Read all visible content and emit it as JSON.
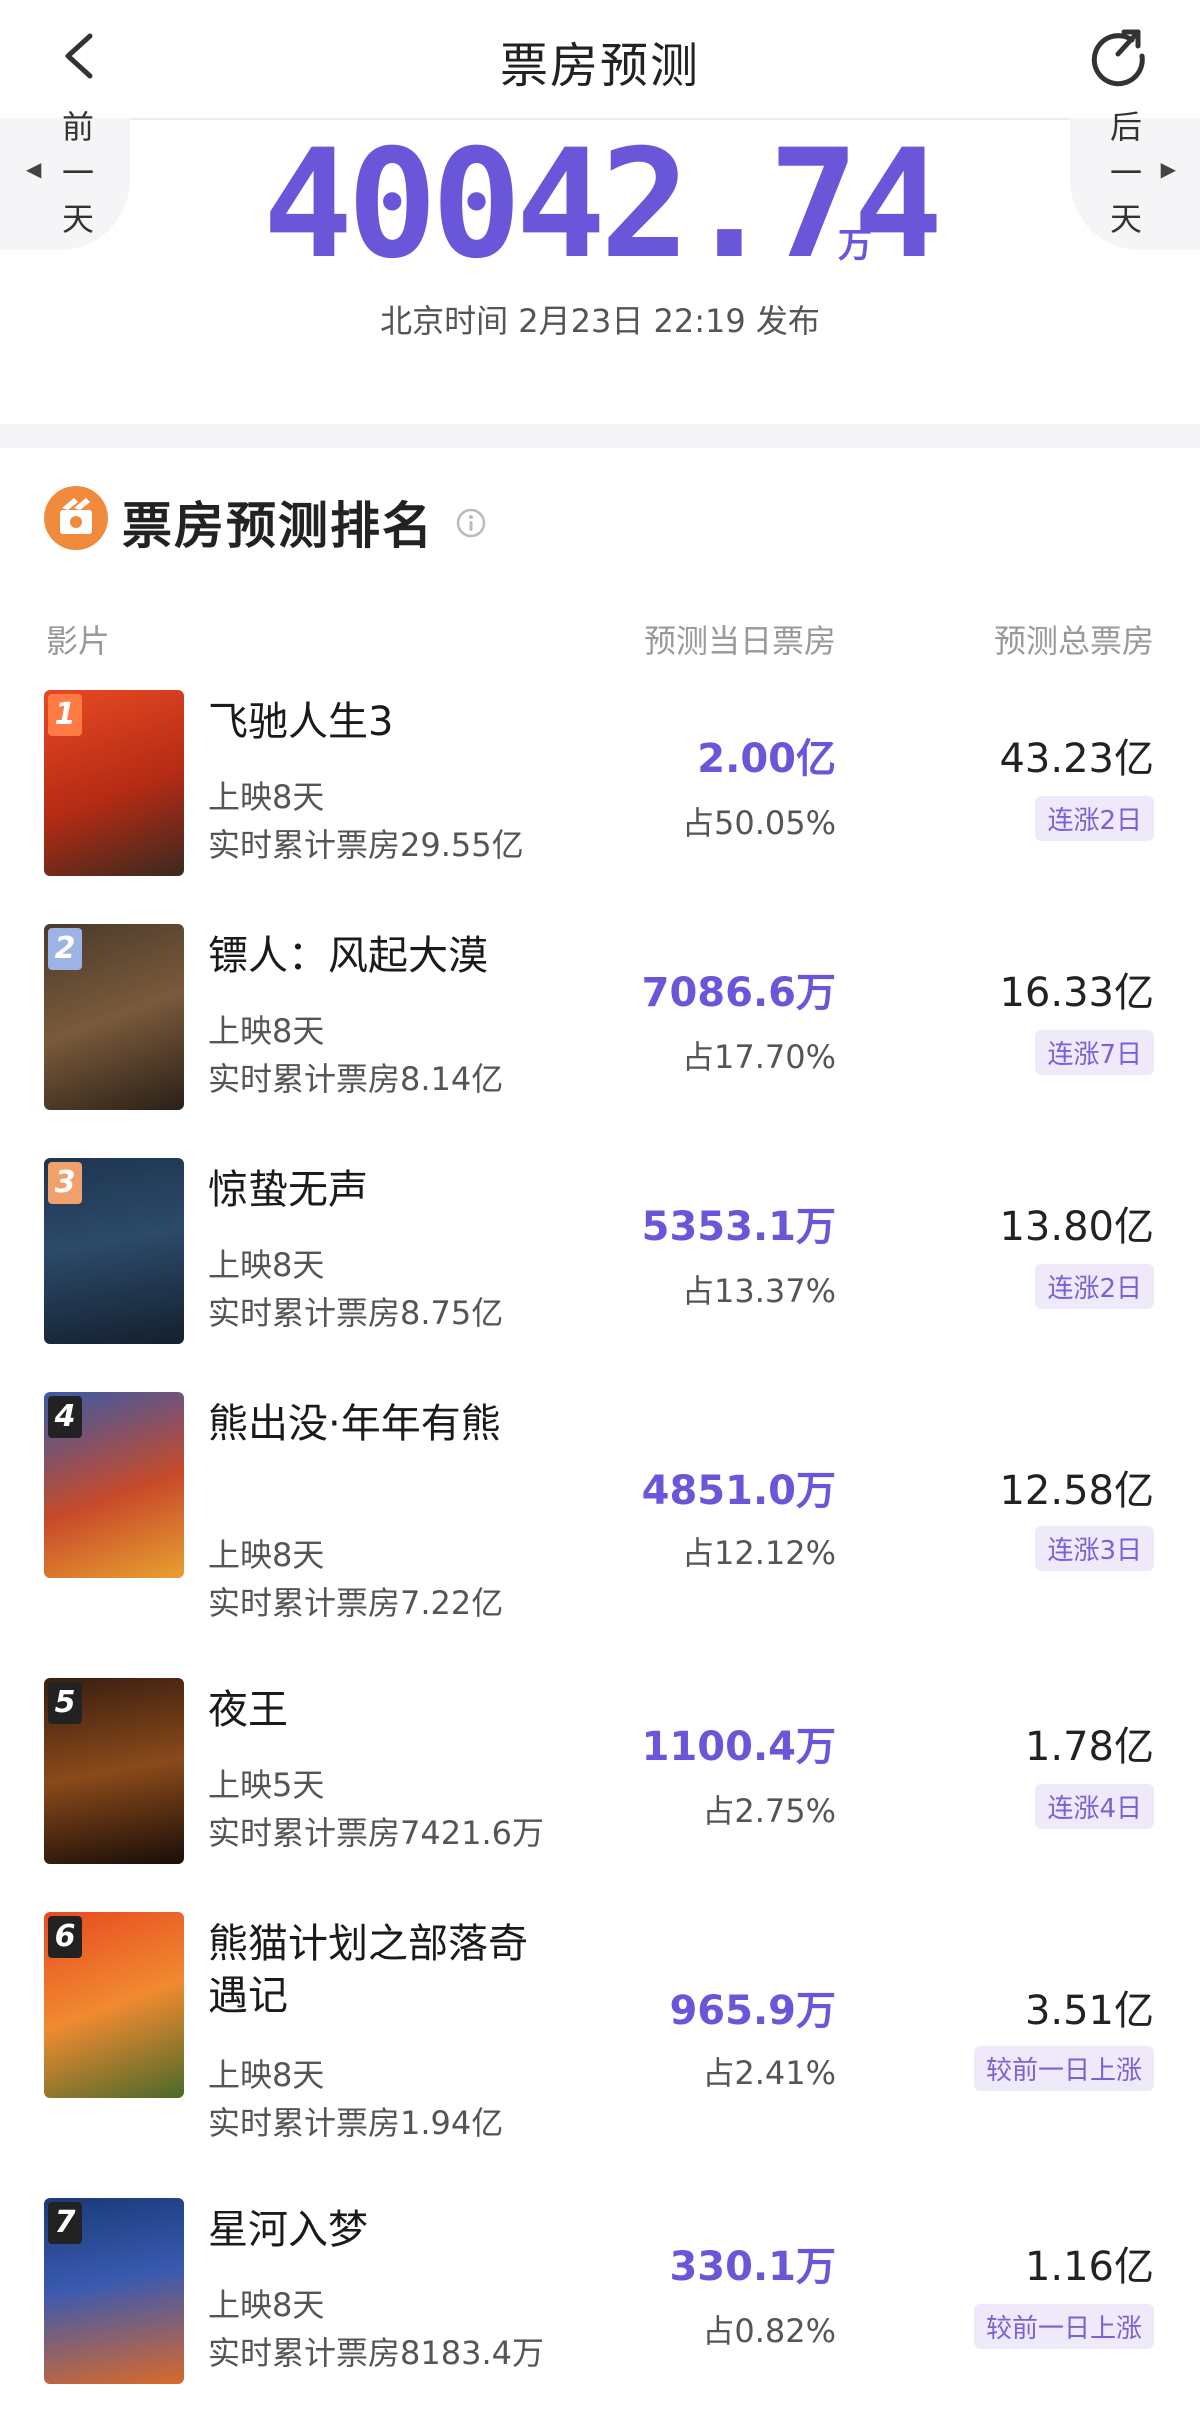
{
  "header": {
    "title": "票房预测"
  },
  "nav": {
    "prev_day": "前一天",
    "next_day": "后一天"
  },
  "summary": {
    "total": "40042.74",
    "unit": "万",
    "published": "北京时间 2月23日 22:19 发布"
  },
  "section": {
    "title": "票房预测排名"
  },
  "columns": {
    "film": "影片",
    "day_forecast": "预测当日票房",
    "total_forecast": "预测总票房"
  },
  "colors": {
    "accent": "#6a56d8",
    "badge_bg": "#eeeaf9"
  },
  "films": [
    {
      "rank": "1",
      "name": "飞驰人生3",
      "days": "上映8天",
      "cumulative": "实时累计票房29.55亿",
      "day_box": "2.00亿",
      "share": "占50.05%",
      "total": "43.23亿",
      "badge": "连涨2日"
    },
    {
      "rank": "2",
      "name": "镖人：风起大漠",
      "days": "上映8天",
      "cumulative": "实时累计票房8.14亿",
      "day_box": "7086.6万",
      "share": "占17.70%",
      "total": "16.33亿",
      "badge": "连涨7日"
    },
    {
      "rank": "3",
      "name": "惊蛰无声",
      "days": "上映8天",
      "cumulative": "实时累计票房8.75亿",
      "day_box": "5353.1万",
      "share": "占13.37%",
      "total": "13.80亿",
      "badge": "连涨2日"
    },
    {
      "rank": "4",
      "name": "熊出没·年年有熊",
      "days": "上映8天",
      "cumulative": "实时累计票房7.22亿",
      "day_box": "4851.0万",
      "share": "占12.12%",
      "total": "12.58亿",
      "badge": "连涨3日"
    },
    {
      "rank": "5",
      "name": "夜王",
      "days": "上映5天",
      "cumulative": "实时累计票房7421.6万",
      "day_box": "1100.4万",
      "share": "占2.75%",
      "total": "1.78亿",
      "badge": "连涨4日"
    },
    {
      "rank": "6",
      "name": "熊猫计划之部落奇遇记",
      "days": "上映8天",
      "cumulative": "实时累计票房1.94亿",
      "day_box": "965.9万",
      "share": "占2.41%",
      "total": "3.51亿",
      "badge": "较前一日上涨"
    },
    {
      "rank": "7",
      "name": "星河入梦",
      "days": "上映8天",
      "cumulative": "实时累计票房8183.4万",
      "day_box": "330.1万",
      "share": "占0.82%",
      "total": "1.16亿",
      "badge": "较前一日上涨"
    }
  ]
}
